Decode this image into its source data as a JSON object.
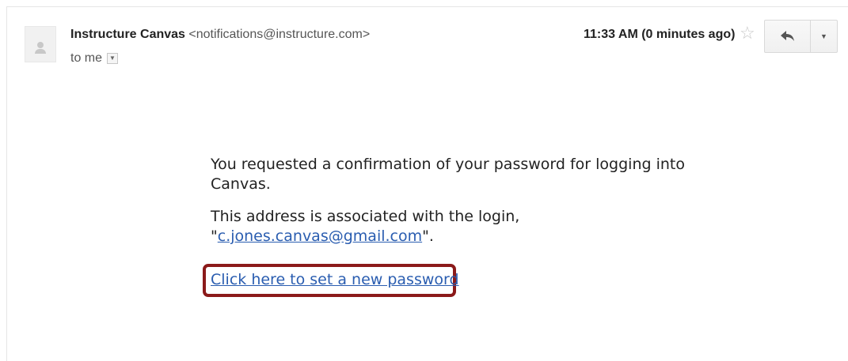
{
  "header": {
    "sender_name": "Instructure Canvas",
    "sender_email": "<notifications@instructure.com>",
    "recipient": "to me",
    "timestamp": "11:33 AM (0 minutes ago)",
    "star_icon": "star-icon",
    "reply_icon": "reply-icon",
    "more_icon": "chevron-down-icon"
  },
  "message": {
    "para1": "You requested a confirmation of your password for logging into Canvas.",
    "para2_prefix": "This address is associated with the login,",
    "login_quote_open": "\"",
    "login_email": "c.jones.canvas@gmail.com",
    "login_quote_close": "\".",
    "reset_link": "Click here to set a new password"
  },
  "colors": {
    "link": "#2a5db0",
    "highlight_border": "#8b1a1a"
  }
}
